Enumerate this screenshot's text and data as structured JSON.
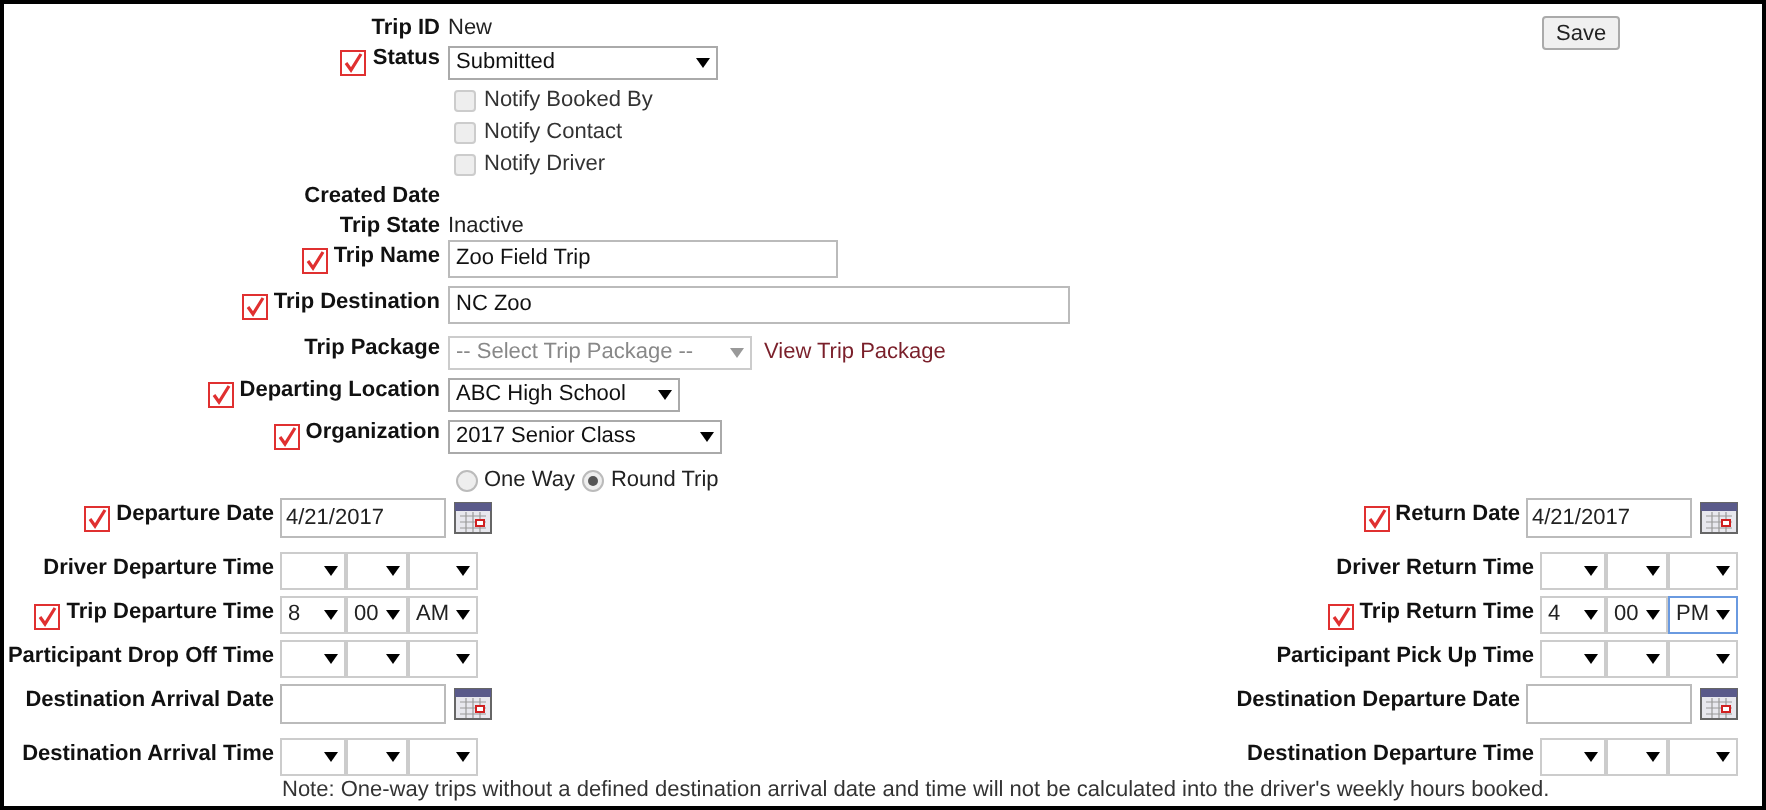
{
  "save_button": "Save",
  "fields": [
    {
      "kind": "text",
      "label": "Trip ID",
      "value": "New",
      "required": false
    },
    {
      "kind": "select",
      "label": "Status",
      "value": "Submitted",
      "required": true,
      "disabled": false
    },
    {
      "kind": "checkbox",
      "label": "Notify Booked By",
      "checked": false,
      "disabled": true
    },
    {
      "kind": "checkbox",
      "label": "Notify Contact",
      "checked": false,
      "disabled": true
    },
    {
      "kind": "checkbox",
      "label": "Notify Driver",
      "checked": false,
      "disabled": true
    },
    {
      "kind": "text",
      "label": "Created Date",
      "required": false
    },
    {
      "kind": "text",
      "label": "Trip State",
      "value": "Inactive",
      "required": false
    },
    {
      "kind": "input",
      "label": "Trip Name",
      "value": "Zoo Field Trip",
      "required": true
    },
    {
      "kind": "input",
      "label": "Trip Destination",
      "value": "NC Zoo",
      "required": true
    },
    {
      "kind": "select",
      "label": "Trip Package",
      "placeholder": "-- Select Trip Package --",
      "disabled": true,
      "link": "View Trip Package",
      "required": false
    },
    {
      "kind": "select",
      "label": "Departing Location",
      "value": "ABC High School",
      "required": true,
      "disabled": false
    },
    {
      "kind": "select",
      "label": "Organization",
      "value": "2017 Senior Class",
      "required": true,
      "disabled": false
    },
    {
      "kind": "radio",
      "options": [
        {
          "label": "One Way",
          "selected": false
        },
        {
          "label": "Round Trip",
          "selected": true
        }
      ]
    }
  ],
  "schedule": [
    {
      "left": {
        "kind": "date",
        "label": "Departure Date",
        "value": "4/21/2017",
        "required": true
      },
      "right": {
        "kind": "date",
        "label": "Return Date",
        "value": "4/21/2017",
        "required": true
      }
    },
    {
      "left": {
        "kind": "time",
        "label": "Driver Departure Time",
        "required": false
      },
      "right": {
        "kind": "time",
        "label": "Driver Return Time",
        "required": false
      }
    },
    {
      "left": {
        "kind": "time",
        "label": "Trip Departure Time",
        "hour": "8",
        "minute": "00",
        "period": "AM",
        "required": true
      },
      "right": {
        "kind": "time",
        "label": "Trip Return Time",
        "hour": "4",
        "minute": "00",
        "period": "PM",
        "required": true
      }
    },
    {
      "left": {
        "kind": "time",
        "label": "Participant Drop Off Time",
        "required": false
      },
      "right": {
        "kind": "time",
        "label": "Participant Pick Up Time",
        "required": false
      }
    },
    {
      "left": {
        "kind": "date",
        "label": "Destination Arrival Date",
        "required": false
      },
      "right": {
        "kind": "date",
        "label": "Destination Departure Date",
        "required": false
      }
    },
    {
      "left": {
        "kind": "time",
        "label": "Destination Arrival Time",
        "required": false
      },
      "right": {
        "kind": "time",
        "label": "Destination Departure Time",
        "required": false
      }
    }
  ],
  "note": "Note: One-way trips without a defined destination arrival date and time will not be calculated into the driver's weekly hours booked."
}
